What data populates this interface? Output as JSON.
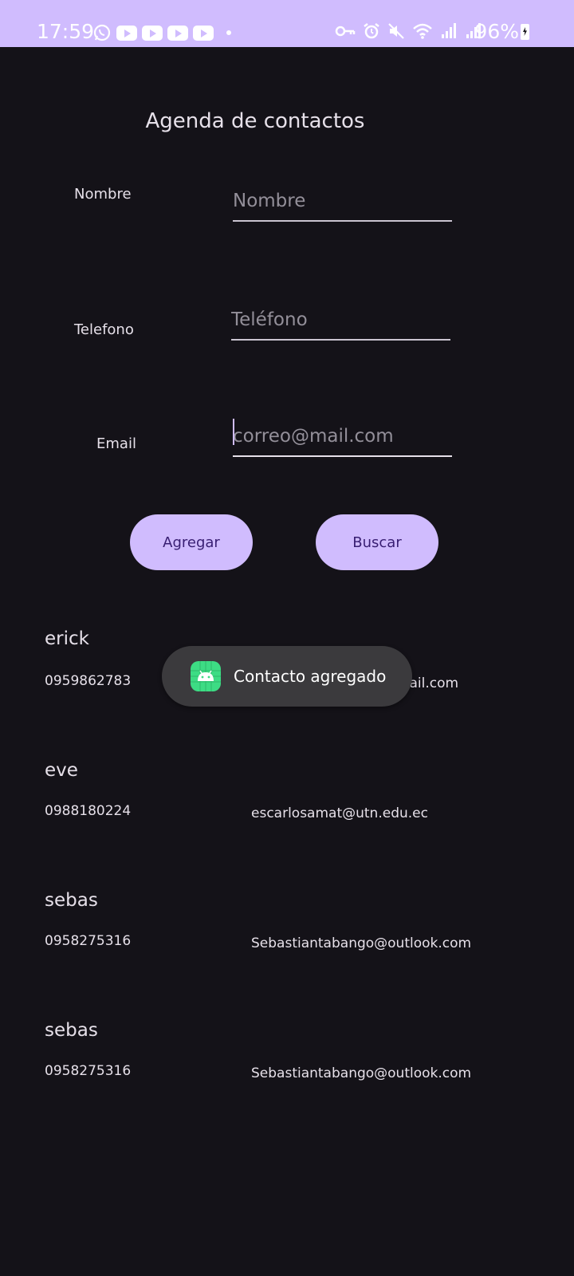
{
  "status_bar": {
    "time": "17:59",
    "battery": "96%",
    "left_icons": [
      "whatsapp-icon",
      "youtube-icon",
      "youtube-icon",
      "youtube-icon",
      "youtube-icon",
      "dot-icon"
    ],
    "right_icons": [
      "key-icon",
      "alarm-icon",
      "mute-icon",
      "wifi-icon",
      "signal-icon",
      "signal-icon",
      "battery-charging-icon"
    ],
    "color": "#d0bcfe"
  },
  "app": {
    "title": "Agenda de contactos",
    "form": {
      "name_label": "Nombre",
      "name_placeholder": "Nombre",
      "phone_label": "Telefono",
      "phone_placeholder": "Teléfono",
      "email_label": "Email",
      "email_placeholder": "correo@mail.com"
    },
    "buttons": {
      "add": "Agregar",
      "search": "Buscar"
    },
    "contacts": [
      {
        "name": "erick",
        "phone": "0959862783",
        "email": "Sebastiantabango@gmail.com"
      },
      {
        "name": "eve",
        "phone": "0988180224",
        "email": "escarlosamat@utn.edu.ec"
      },
      {
        "name": "sebas",
        "phone": "0958275316",
        "email": "Sebastiantabango@outlook.com"
      },
      {
        "name": "sebas",
        "phone": "0958275316",
        "email": "Sebastiantabango@outlook.com"
      }
    ]
  },
  "toast": {
    "message": "Contacto agregado",
    "icon": "android-app-icon"
  },
  "colors": {
    "background": "#141218",
    "accent": "#d0bcfe",
    "on_accent": "#381e72",
    "toast_bg": "#3b3a3d"
  }
}
